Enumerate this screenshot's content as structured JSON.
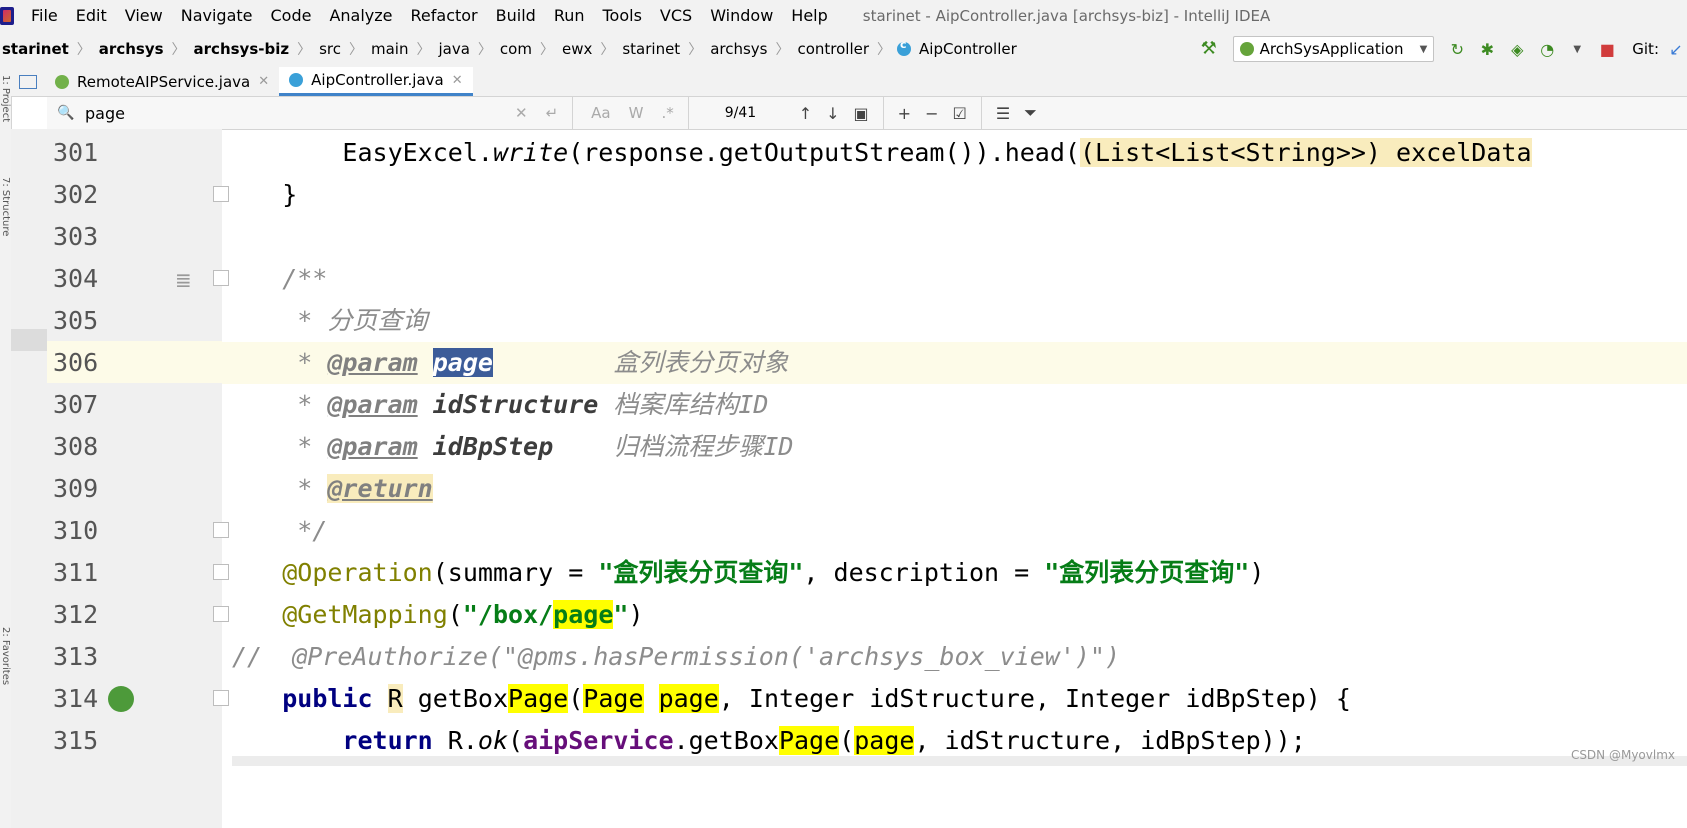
{
  "menu": {
    "items": [
      "File",
      "Edit",
      "View",
      "Navigate",
      "Code",
      "Analyze",
      "Refactor",
      "Build",
      "Run",
      "Tools",
      "VCS",
      "Window",
      "Help"
    ],
    "window_title": "starinet - AipController.java [archsys-biz] - IntelliJ IDEA"
  },
  "breadcrumb": [
    "starinet",
    "archsys",
    "archsys-biz",
    "src",
    "main",
    "java",
    "com",
    "ewx",
    "starinet",
    "archsys",
    "controller",
    "AipController"
  ],
  "toolbar": {
    "run_config": "ArchSysApplication",
    "git_label": "Git:"
  },
  "tabs": [
    {
      "label": "RemoteAIPService.java",
      "type": "interface"
    },
    {
      "label": "AipController.java",
      "type": "class",
      "active": true
    }
  ],
  "find": {
    "query": "page",
    "match_count": "9/41",
    "option_case": "Aa",
    "option_words": "W",
    "option_regex": ".*"
  },
  "left_strip": {
    "project_label": "1: Project",
    "structure_label": "7: Structure",
    "favorites_label": "2: Favorites"
  },
  "line_numbers": [
    "301",
    "302",
    "303",
    "304",
    "305",
    "306",
    "307",
    "308",
    "309",
    "310",
    "311",
    "312",
    "313",
    "314",
    "315"
  ],
  "code": {
    "l301": {
      "a": "        EasyExcel.",
      "b": "write",
      "c": "(response.getOutputStream()).head(",
      "d": "(List<List<String>>) excelData"
    },
    "l302": "    }",
    "l304": "    /**",
    "l305": "     * 分页查询",
    "l306": {
      "pre": "     * ",
      "tag": "@param",
      "sp": " ",
      "name": "page",
      "pad": "        ",
      "desc": "盒列表分页对象"
    },
    "l307": {
      "pre": "     * ",
      "tag": "@param",
      "sp": " ",
      "name": "idStructure",
      "pad": " ",
      "desc": "档案库结构ID"
    },
    "l308": {
      "pre": "     * ",
      "tag": "@param",
      "sp": " ",
      "name": "idBpStep",
      "pad": "    ",
      "desc": "归档流程步骤ID"
    },
    "l309": {
      "pre": "     * ",
      "tag": "@return"
    },
    "l310": "     */",
    "l311": {
      "ann": "@Operation",
      "a": "(summary = ",
      "s1": "\"盒列表分页查询\"",
      "b": ", description = ",
      "s2": "\"盒列表分页查询\"",
      "c": ")"
    },
    "l312": {
      "ann": "@GetMapping",
      "a": "(",
      "s1": "\"/box/",
      "hl": "page",
      "s2": "\"",
      "b": ")"
    },
    "l313": "//  @PreAuthorize(\"@pms.hasPermission('archsys_box_view')\")",
    "l314": {
      "kw": "public",
      "r": "R",
      "a": " getBox",
      "hl1": "Page",
      "b": "(",
      "hl2": "Page",
      "c": " ",
      "hl3": "page",
      "d": ", Integer idStructure, Integer idBpStep) {"
    },
    "l315": {
      "kw": "return",
      "a": " R.",
      "ok": "ok",
      "b": "(",
      "fld": "aipService",
      "c": ".getBox",
      "hl1": "Page",
      "d": "(",
      "hl2": "page",
      "e": ", idStructure, idBpStep));"
    }
  },
  "watermark": "CSDN @Myovlmx"
}
